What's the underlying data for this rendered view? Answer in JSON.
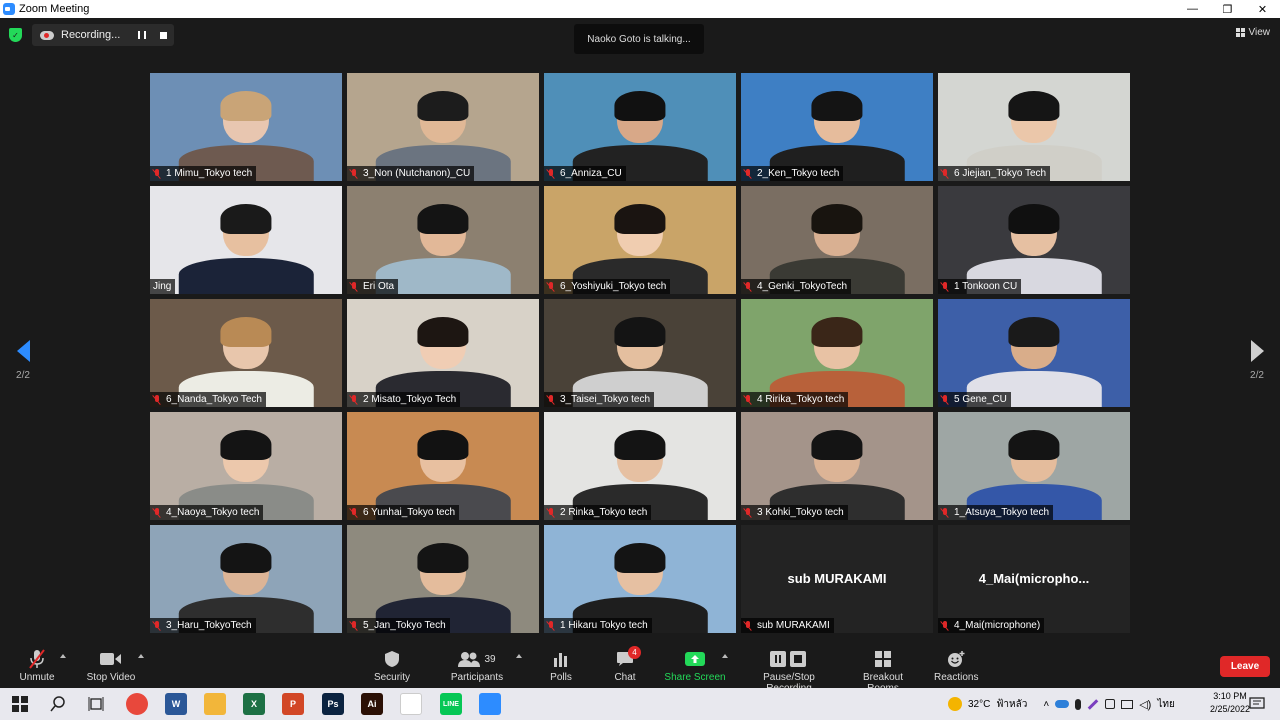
{
  "window": {
    "title": "Zoom Meeting",
    "min": "—",
    "max": "❐",
    "close": "✕"
  },
  "topbar": {
    "recording_label": "Recording...",
    "talking": "Naoko Goto is talking...",
    "view_label": "View"
  },
  "nav": {
    "left_page": "2/2",
    "right_page": "2/2"
  },
  "participants": [
    {
      "name": "1 Mimu_Tokyo tech",
      "muted": true,
      "bg": "#6d8fb5",
      "skin": "#e8c6b0",
      "hair": "#c9a477",
      "shirt": "#6e5a50"
    },
    {
      "name": "3_Non (Nutchanon)_CU",
      "muted": true,
      "bg": "#b5a58e",
      "skin": "#e0b896",
      "hair": "#1c1c1c",
      "shirt": "#6b7480"
    },
    {
      "name": "6_Anniza_CU",
      "muted": true,
      "bg": "#4f8fb8",
      "skin": "#d8a888",
      "hair": "#111111",
      "shirt": "#222222"
    },
    {
      "name": "2_Ken_Tokyo tech",
      "muted": true,
      "bg": "#3e7fc4",
      "skin": "#e6bc9c",
      "hair": "#141414",
      "shirt": "#1f1f1f"
    },
    {
      "name": "6 Jiejian_Tokyo Tech",
      "muted": true,
      "bg": "#d4d6d2",
      "skin": "#ebc7aa",
      "hair": "#151515",
      "shirt": "#d0cfc8"
    },
    {
      "name": "Jing",
      "muted": false,
      "bg": "#e6e6ea",
      "skin": "#e7c0a0",
      "hair": "#1a1a1a",
      "shirt": "#1b2338"
    },
    {
      "name": "Eri Ota",
      "muted": true,
      "bg": "#8c8070",
      "skin": "#e2b898",
      "hair": "#141414",
      "shirt": "#9fb8c8"
    },
    {
      "name": "6_Yoshiyuki_Tokyo tech",
      "muted": true,
      "bg": "#c9a468",
      "skin": "#f0cdb0",
      "hair": "#1a1411",
      "shirt": "#2a2a2a"
    },
    {
      "name": "4_Genki_TokyoTech",
      "muted": true,
      "bg": "#7a6e62",
      "skin": "#d9b092",
      "hair": "#18140f",
      "shirt": "#3a3a34"
    },
    {
      "name": "1 Tonkoon CU",
      "muted": true,
      "bg": "#3a3a3e",
      "skin": "#e6c0a2",
      "hair": "#101010",
      "shirt": "#d8d8e0"
    },
    {
      "name": "6_Nanda_Tokyo Tech",
      "muted": true,
      "bg": "#6c5a4a",
      "skin": "#e8c6ac",
      "hair": "#b98a55",
      "shirt": "#ecece4"
    },
    {
      "name": "2 Misato_Tokyo Tech",
      "muted": true,
      "bg": "#d8d2c8",
      "skin": "#f0cdb4",
      "hair": "#1d1612",
      "shirt": "#2a2a30"
    },
    {
      "name": "3_Taisei_Tokyo tech",
      "muted": true,
      "bg": "#4a4238",
      "skin": "#e4bf9f",
      "hair": "#141414",
      "shirt": "#cfcfcf"
    },
    {
      "name": "4 Ririka_Tokyo tech",
      "muted": true,
      "bg": "#7fa46b",
      "skin": "#e8c2a4",
      "hair": "#3a2618",
      "shirt": "#b8613a"
    },
    {
      "name": "5 Gene_CU",
      "muted": true,
      "bg": "#3d5fa8",
      "skin": "#d9ad8a",
      "hair": "#1a1a1a",
      "shirt": "#e0e0e8"
    },
    {
      "name": "4_Naoya_Tokyo tech",
      "muted": true,
      "bg": "#b9aea4",
      "skin": "#ecc8ac",
      "hair": "#141414",
      "shirt": "#8a8c88"
    },
    {
      "name": "6 Yunhai_Tokyo tech",
      "muted": true,
      "bg": "#c88a52",
      "skin": "#e8c0a0",
      "hair": "#121212",
      "shirt": "#4a4a4e"
    },
    {
      "name": "2 Rinka_Tokyo tech",
      "muted": true,
      "bg": "#e4e4e2",
      "skin": "#e6c0a2",
      "hair": "#141414",
      "shirt": "#2a2a2a"
    },
    {
      "name": "3 Kohki_Tokyo tech",
      "muted": true,
      "bg": "#a4948a",
      "skin": "#dcb496",
      "hair": "#141414",
      "shirt": "#2e2e2e"
    },
    {
      "name": "1_Atsuya_Tokyo tech",
      "muted": true,
      "bg": "#9ea6a4",
      "skin": "#e4bc9c",
      "hair": "#141414",
      "shirt": "#3457a8"
    },
    {
      "name": "3_Haru_TokyoTech",
      "muted": true,
      "bg": "#8ea4b8",
      "skin": "#dcb496",
      "hair": "#141414",
      "shirt": "#2e2e2e"
    },
    {
      "name": "5_Jan_Tokyo Tech",
      "muted": true,
      "bg": "#8e8a7e",
      "skin": "#e4bc9c",
      "hair": "#141414",
      "shirt": "#202434"
    },
    {
      "name": "1 Hikaru Tokyo tech",
      "muted": true,
      "bg": "#8fb4d6",
      "skin": "#e6c0a2",
      "hair": "#141414",
      "shirt": "#1e1e1e"
    },
    {
      "name": "sub MURAKAMI",
      "muted": true,
      "name_only": true,
      "display": "sub MURAKAMI"
    },
    {
      "name": "4_Mai(microphone)",
      "muted": true,
      "name_only": true,
      "display": "4_Mai(micropho..."
    }
  ],
  "toolbar": {
    "unmute": "Unmute",
    "stop_video": "Stop Video",
    "security": "Security",
    "participants": "Participants",
    "participants_count": "39",
    "polls": "Polls",
    "chat": "Chat",
    "chat_badge": "4",
    "share_screen": "Share Screen",
    "pause_stop": "Pause/Stop Recording",
    "breakout": "Breakout Rooms",
    "reactions": "Reactions",
    "leave": "Leave"
  },
  "taskbar": {
    "weather": "32°C",
    "weather_desc": "ฟ้าหลัว",
    "ime": "ไทย",
    "time": "3:10 PM",
    "date": "2/25/2022",
    "apps": [
      {
        "id": "chrome",
        "label": "",
        "color": "#e8483c"
      },
      {
        "id": "word",
        "label": "W",
        "color": "#2b5797"
      },
      {
        "id": "explorer",
        "label": "",
        "color": "#f2b63a"
      },
      {
        "id": "excel",
        "label": "X",
        "color": "#1d7044"
      },
      {
        "id": "powerpoint",
        "label": "P",
        "color": "#d24726"
      },
      {
        "id": "photoshop",
        "label": "Ps",
        "color": "#0b2340"
      },
      {
        "id": "illustrator",
        "label": "Ai",
        "color": "#2b1005"
      },
      {
        "id": "slack",
        "label": "",
        "color": "#ffffff"
      },
      {
        "id": "line",
        "label": "LINE",
        "color": "#06c755"
      },
      {
        "id": "zoom",
        "label": "",
        "color": "#2d8cff"
      }
    ]
  }
}
